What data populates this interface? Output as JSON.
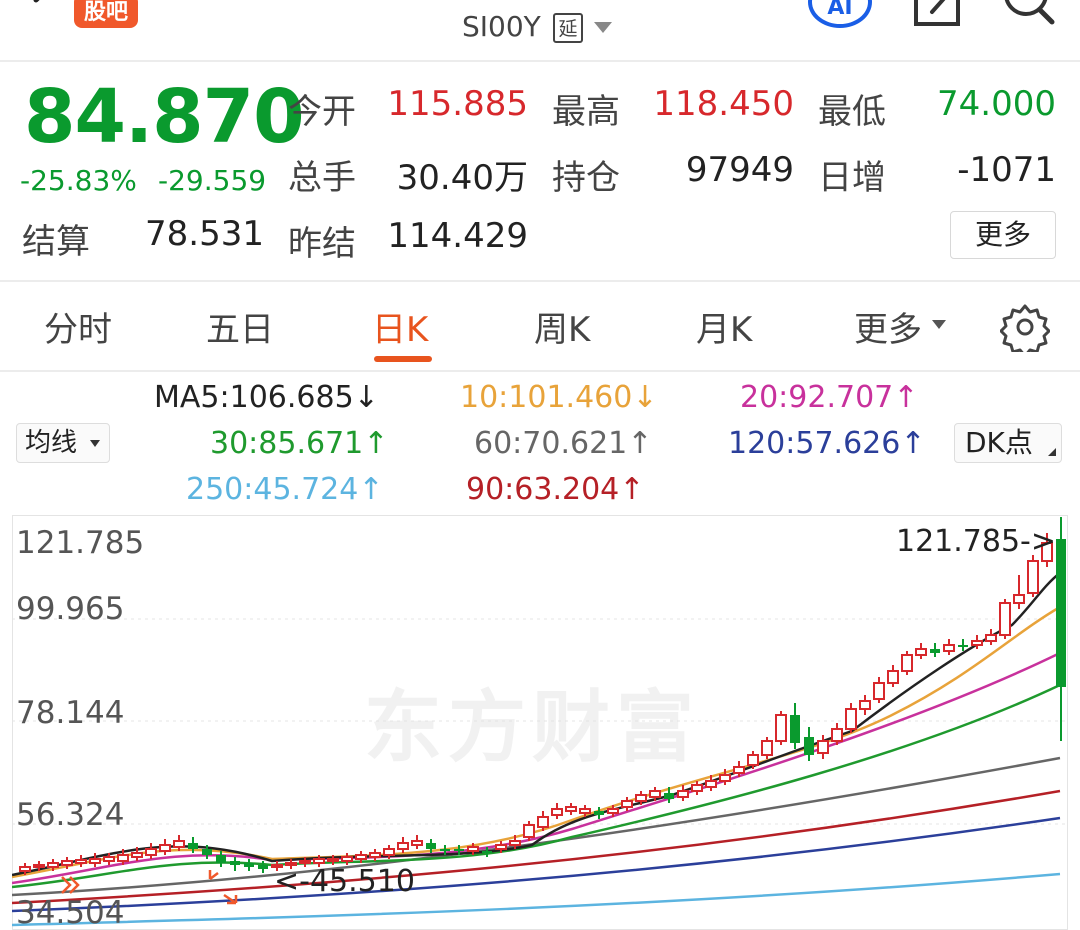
{
  "header": {
    "badge": "股吧",
    "symbol": "SI00Y",
    "delay": "延",
    "ai": "AI"
  },
  "quote": {
    "price": "84.870",
    "change_pct": "-25.83%",
    "change_abs": "-29.559",
    "settle_label": "结算",
    "settle_value": "78.531",
    "prev_settle_label": "昨结",
    "prev_settle_value": "114.429",
    "open_label": "今开",
    "open_value": "115.885",
    "high_label": "最高",
    "high_value": "118.450",
    "low_label": "最低",
    "low_value": "74.000",
    "volume_label": "总手",
    "volume_value": "30.40万",
    "oi_label": "持仓",
    "oi_value": "97949",
    "oi_change_label": "日增",
    "oi_change_value": "-1071",
    "more": "更多"
  },
  "tabs": [
    {
      "label": "分时",
      "active": false
    },
    {
      "label": "五日",
      "active": false
    },
    {
      "label": "日K",
      "active": true
    },
    {
      "label": "周K",
      "active": false
    },
    {
      "label": "月K",
      "active": false
    },
    {
      "label": "更多",
      "active": false
    }
  ],
  "ma_toggle": "均线",
  "dk_button": "DK点",
  "ma_legend": [
    {
      "text": "MA5:106.685↓",
      "color": "#222222"
    },
    {
      "text": "10:101.460↓",
      "color": "#e8a33a"
    },
    {
      "text": "20:92.707↑",
      "color": "#c8319c"
    },
    {
      "text": "30:85.671↑",
      "color": "#1f9a2e"
    },
    {
      "text": "60:70.621↑",
      "color": "#666666"
    },
    {
      "text": "120:57.626↑",
      "color": "#2b3f9a"
    },
    {
      "text": "250:45.724↑",
      "color": "#5cb4e0"
    },
    {
      "text": "90:63.204↑",
      "color": "#b52026"
    }
  ],
  "chart": {
    "watermark": "东方财富",
    "y_labels": [
      "121.785",
      "99.965",
      "78.144",
      "56.324",
      "34.504"
    ],
    "y_values": [
      121.785,
      99.965,
      78.144,
      56.324,
      34.504
    ],
    "max_annotation": "121.785->",
    "min_annotation": "<-45.510",
    "colors": {
      "up": "#d7282c",
      "down": "#0a9a2e"
    }
  },
  "chart_data": {
    "type": "candlestick",
    "ylim": [
      34.504,
      121.785
    ],
    "highest": 121.785,
    "lowest": 45.51,
    "series": [
      {
        "name": "MA5",
        "last": 106.685
      },
      {
        "name": "MA10",
        "last": 101.46
      },
      {
        "name": "MA20",
        "last": 92.707
      },
      {
        "name": "MA30",
        "last": 85.671
      },
      {
        "name": "MA60",
        "last": 70.621
      },
      {
        "name": "MA90",
        "last": 63.204
      },
      {
        "name": "MA120",
        "last": 57.626
      },
      {
        "name": "MA250",
        "last": 45.724
      }
    ]
  }
}
